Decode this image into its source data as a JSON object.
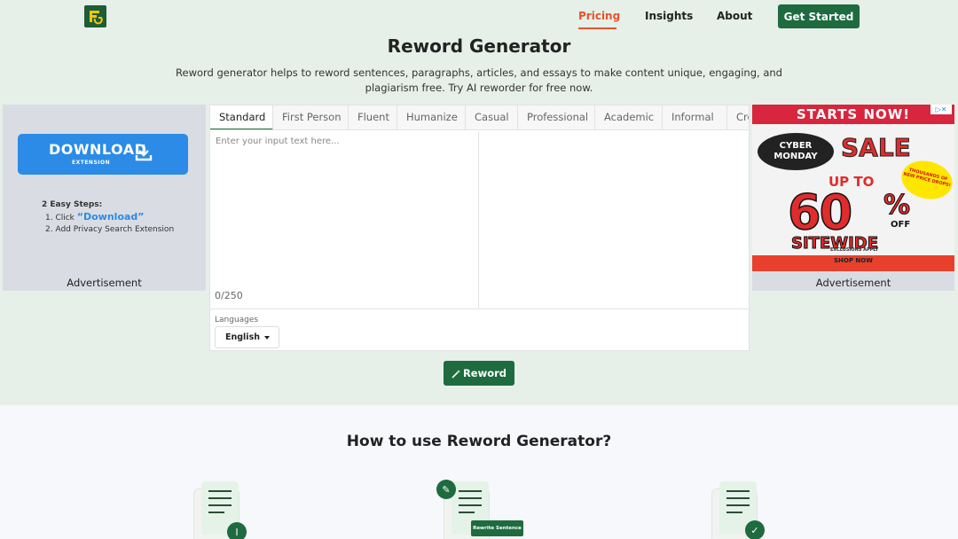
{
  "nav": {
    "logo_text": "FG",
    "links": [
      {
        "label": "Pricing",
        "active": true
      },
      {
        "label": "Insights",
        "active": false
      },
      {
        "label": "About",
        "active": false
      }
    ],
    "cta_label": "Get Started"
  },
  "hero": {
    "title": "Reword Generator",
    "description": "Reword generator helps to reword sentences, paragraphs, articles, and essays to make content unique, engaging, and plagiarism free. Try AI reworder for free now."
  },
  "ad_left": {
    "download_label": "DOWNLOAD",
    "download_sub": "EXTENSION",
    "steps_title": "2 Easy Steps:",
    "step1_prefix": "1. Click ",
    "step1_highlight": "“Download”",
    "step2": "2. Add Privacy Search Extension",
    "label": "Advertisement"
  },
  "ad_right": {
    "headline": "STARTS NOW!",
    "badge1": "CYBER MONDAY",
    "sale": "SALE",
    "burst": "THOUSANDS OF NEW PRICE DROPS!",
    "upto": "UP TO",
    "percent": "60",
    "percent_sign": "%",
    "off": "OFF",
    "sitewide": "SITEWIDE",
    "exclusions": "EXCLUSIONS APPLY",
    "shop": "SHOP NOW",
    "label": "Advertisement"
  },
  "editor": {
    "tabs": [
      "Standard",
      "First Person",
      "Fluent",
      "Humanize",
      "Casual",
      "Professional",
      "Academic",
      "Informal",
      "Creative"
    ],
    "active_tab": "Standard",
    "input_placeholder": "Enter your input text here...",
    "counter": "0/250",
    "languages_label": "Languages",
    "language_value": "English"
  },
  "reword_button": "Reword",
  "howto": {
    "title": "How to use Reword Generator?",
    "chip_label": "Rewrite Sentence"
  },
  "colors": {
    "brand_green": "#1d6b3f",
    "accent_orange": "#e4552b",
    "page_bg": "#e7efe9"
  }
}
